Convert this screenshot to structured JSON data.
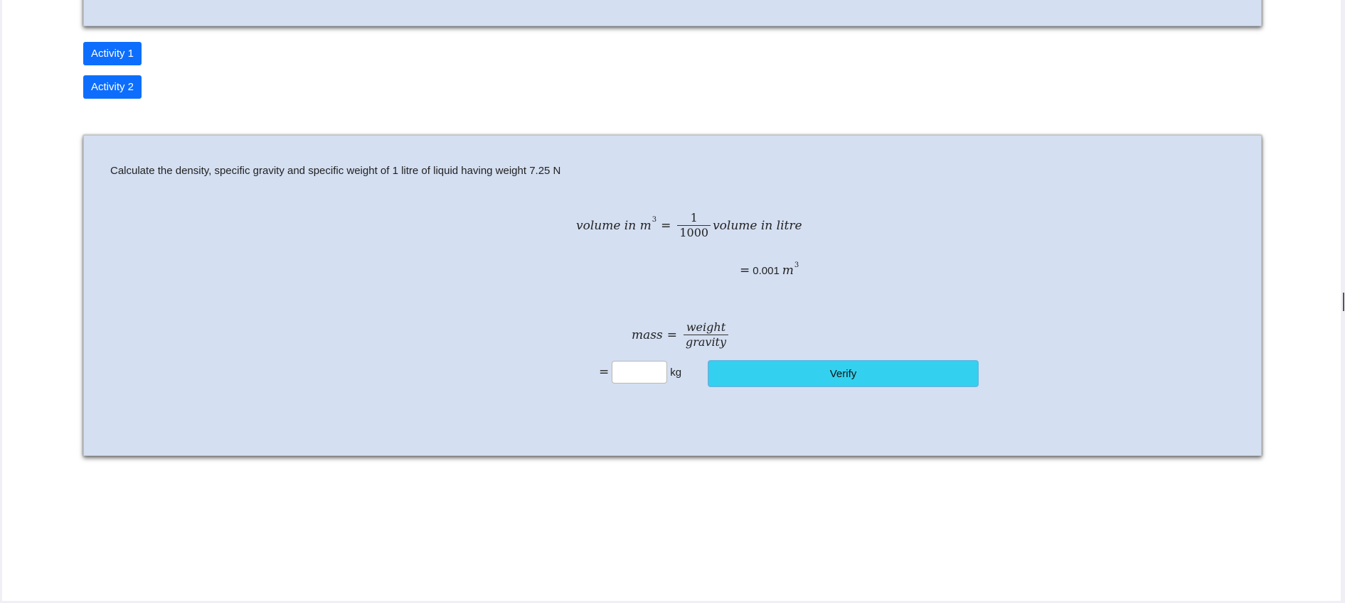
{
  "nav": {
    "activity_1_label": "Activity 1",
    "activity_2_label": "Activity 2"
  },
  "problem": {
    "question": "Calculate the density, specific gravity and specific weight of 1 litre of liquid having weight 7.25 N"
  },
  "volume_formula": {
    "lhs": "volume in m",
    "lhs_exponent": "3",
    "equals": "=",
    "numerator": "1",
    "denominator": "1000",
    "rhs": "volume in litre"
  },
  "volume_result": {
    "equals": "=",
    "value": "0.001",
    "unit": "m",
    "unit_exponent": "3"
  },
  "mass_formula": {
    "lhs": "mass",
    "equals": "=",
    "numerator": "weight",
    "denominator": "gravity"
  },
  "mass_answer": {
    "equals": "=",
    "input_value": "",
    "unit": "kg",
    "verify_label": "Verify"
  },
  "colors": {
    "panel_background": "#d4dff1",
    "primary_button": "#0d6efd",
    "verify_button": "#33d1ef"
  }
}
